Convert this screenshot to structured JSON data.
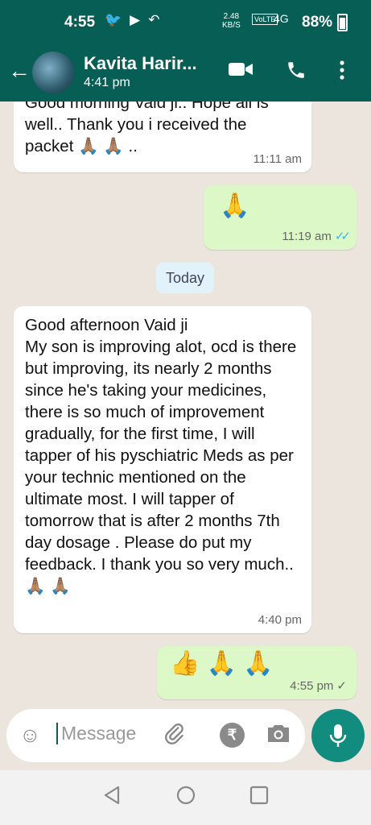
{
  "status": {
    "time": "4:55",
    "net_speed": "2.48",
    "net_unit": "KB/S",
    "volte": "VoLTE",
    "signal": "4G",
    "battery": "88%"
  },
  "header": {
    "contact_name": "Kavita Harir...",
    "last_seen": "4:41 pm"
  },
  "messages": [
    {
      "direction": "in",
      "text": "Good morning Vaid ji.. Hope all is well.. Thank you i received the packet 🙏🏽 🙏🏽 ..",
      "time": "11:11 am"
    },
    {
      "direction": "out",
      "text": "🙏",
      "time": "11:19 am",
      "status": "read"
    },
    {
      "direction": "in",
      "text": "Good afternoon Vaid ji\nMy son is improving alot, ocd is there but improving, its nearly 2 months since he's taking your medicines, there is so much of improvement gradually, for the first time, I will tapper of his pyschiatric Meds as per your technic mentioned on the ultimate most. I will tapper of tomorrow that is after 2 months 7th day dosage . Please do put my feedback. I thank you so very much.. 🙏🏽 🙏🏽",
      "time": "4:40 pm"
    },
    {
      "direction": "out",
      "text": "👍 🙏 🙏",
      "time": "4:55 pm",
      "status": "sent"
    }
  ],
  "date_chip": "Today",
  "composer": {
    "placeholder": "Message"
  },
  "icons": [
    "back-arrow-icon",
    "video-call-icon",
    "phone-call-icon",
    "more-options-icon",
    "emoji-icon",
    "attach-icon",
    "rupee-icon",
    "camera-icon",
    "mic-icon"
  ],
  "colors": {
    "header": "#075e54",
    "outgoing_bubble": "#dcf8c6",
    "incoming_bubble": "#ffffff",
    "read_ticks": "#34b7f1",
    "mic_button": "#128c7e"
  }
}
